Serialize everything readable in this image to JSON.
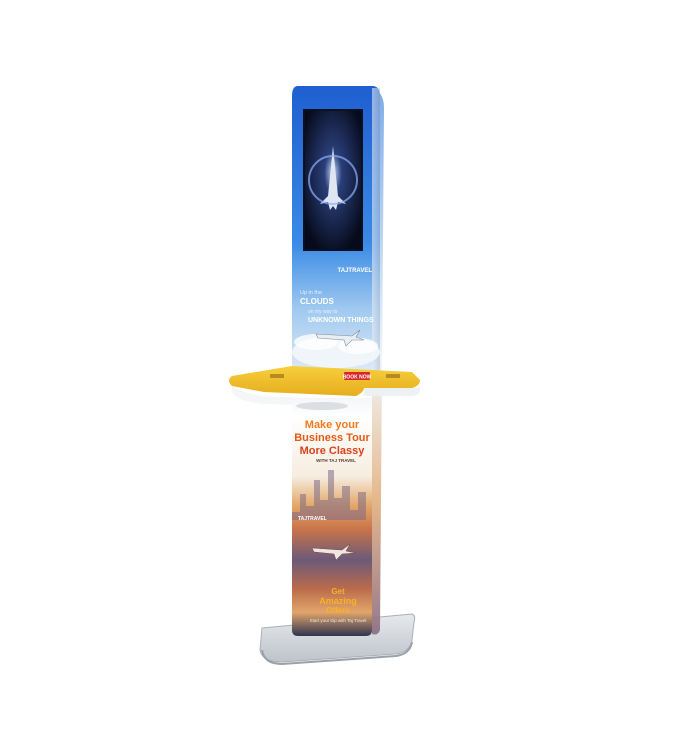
{
  "kiosk": {
    "top_panel": {
      "brand": "TAJTRAVEL",
      "tagline_1": "Up in the",
      "tagline_2": "CLOUDS",
      "tagline_3": "on my way to",
      "tagline_4": "UNKNOWN THINGS"
    },
    "tray": {
      "button": "BOOK NOW"
    },
    "lower_panel": {
      "headline_1": "Make your",
      "headline_2": "Business Tour",
      "headline_3": "More Classy",
      "subline": "WITH TAJ TRAVEL",
      "brand": "TAJTRAVEL",
      "offer_1": "Get",
      "offer_2": "Amazing",
      "offer_3": "Offers",
      "footer": "Start your trip with Taj Travel"
    },
    "colors": {
      "panel_blue": "#2a6fd6",
      "tray_yellow": "#f2c230",
      "headline_orange": "#f07a1c",
      "base_gray": "#cfd3d8"
    }
  }
}
